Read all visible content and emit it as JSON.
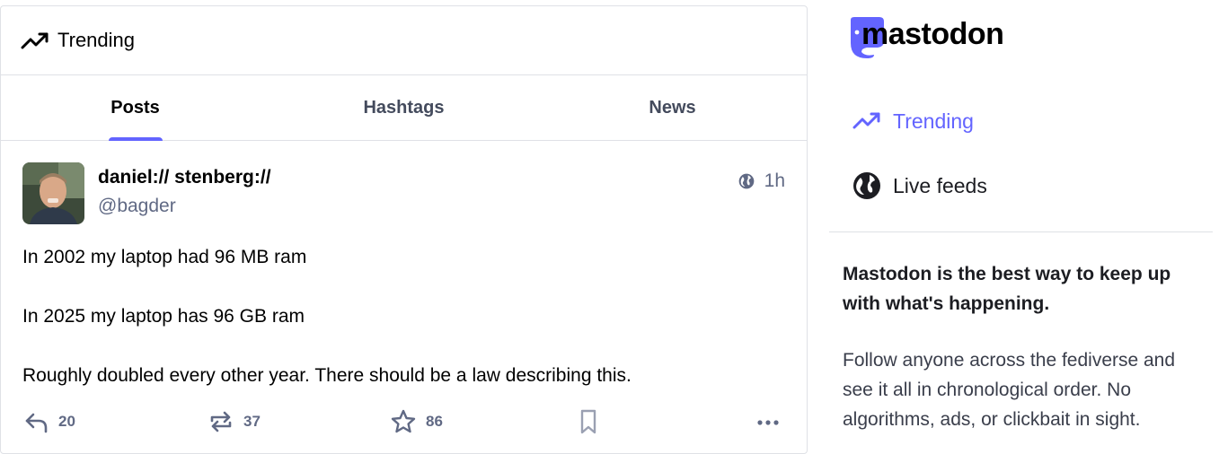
{
  "column": {
    "title": "Trending",
    "icon": "trending-icon"
  },
  "tabs": [
    {
      "label": "Posts",
      "active": true
    },
    {
      "label": "Hashtags",
      "active": false
    },
    {
      "label": "News",
      "active": false
    }
  ],
  "post": {
    "display_name": "daniel:// stenberg://",
    "username": "@bagder",
    "visibility_icon": "globe-icon",
    "time": "1h",
    "paragraphs": [
      "In 2002 my laptop had 96 MB ram",
      "In 2025 my laptop has 96 GB ram",
      "Roughly doubled every other year. There should be a law describing this."
    ],
    "replies": "20",
    "boosts": "37",
    "favourites": "86"
  },
  "sidebar": {
    "logo_text": "mastodon",
    "nav": [
      {
        "label": "Trending",
        "icon": "trending-icon",
        "active": true
      },
      {
        "label": "Live feeds",
        "icon": "globe-icon",
        "active": false
      }
    ],
    "pitch_headline": "Mastodon is the best way to keep up with what's happening.",
    "pitch_body": "Follow anyone across the fediverse and see it all in chronological order. No algorithms, ads, or clickbait in sight."
  },
  "colors": {
    "accent": "#6364ff",
    "muted": "#606984",
    "border": "#dfe1e6"
  }
}
